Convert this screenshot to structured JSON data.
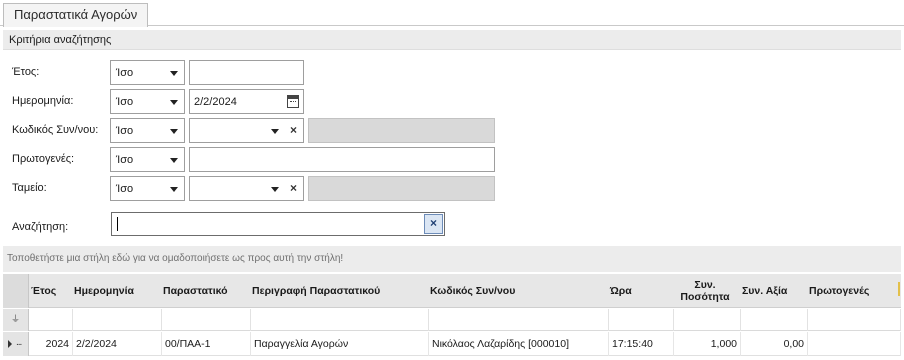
{
  "window": {
    "tab_title": "Παραστατικά Αγορών"
  },
  "criteria": {
    "header": "Κριτήρια αναζήτησης",
    "fields": [
      {
        "label": "Έτος:",
        "operator": "Ίσο",
        "value": ""
      },
      {
        "label": "Ημερομηνία:",
        "operator": "Ίσο",
        "value": "2/2/2024"
      },
      {
        "label": "Κωδικός Συν/νου:",
        "operator": "Ίσο",
        "value": "",
        "description": ""
      },
      {
        "label": "Πρωτογενές:",
        "operator": "Ίσο",
        "value": ""
      },
      {
        "label": "Ταμείο:",
        "operator": "Ίσο",
        "value": "",
        "description": ""
      }
    ],
    "search": {
      "label": "Αναζήτηση:",
      "value": "",
      "clear_glyph": "×"
    },
    "clear_glyph": "×"
  },
  "grid": {
    "group_hint": "Τοποθετήστε μια στήλη εδώ για να ομαδοποιήσετε ως προς αυτή την στήλη!",
    "filter_icon": "filter-icon",
    "filter_glyph": "⏚",
    "columns": [
      "Έτος",
      "Ημερομηνία",
      "Παραστατικό",
      "Περιγραφή Παραστατικού",
      "Κωδικός Συν/νου",
      "Ώρα",
      "Συν. Ποσότητα",
      "Συν. Αξία",
      "Πρωτογενές"
    ],
    "rows": [
      {
        "year": "2024",
        "date": "2/2/2024",
        "doc": "00/ΠΑΑ-1",
        "desc": "Παραγγελία Αγορών",
        "partner": "Νικόλαος Λαζαρίδης [000010]",
        "time": "17:15:40",
        "qty": "1,000",
        "value": "0,00",
        "primary": ""
      }
    ],
    "row_marker": "..."
  },
  "colors": {
    "header_bg": "#e7e7e7",
    "group_bar_bg": "#ececec",
    "readonly_bg": "#d9d9d9",
    "clear_button_bg": "#dbe6f4"
  }
}
